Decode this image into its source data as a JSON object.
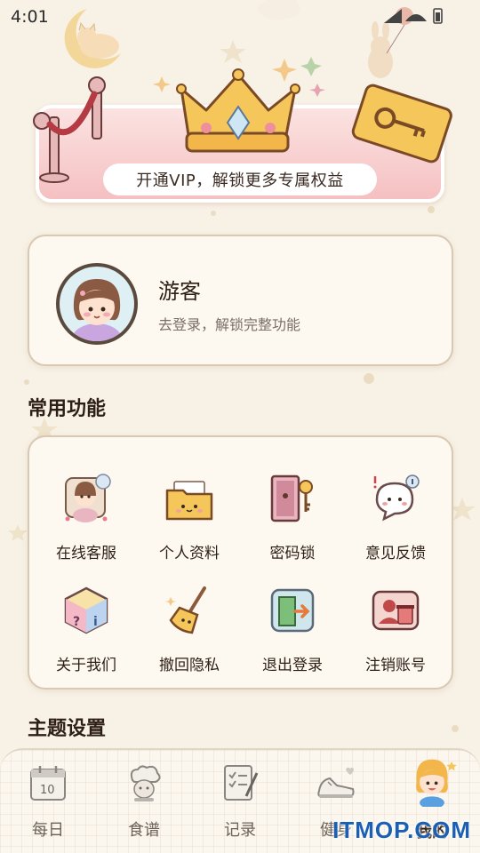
{
  "status_bar": {
    "time": "4:01"
  },
  "vip_banner": {
    "text": "开通VIP，解锁更多专属权益"
  },
  "profile": {
    "name": "游客",
    "subtitle": "去登录，解锁完整功能"
  },
  "sections": {
    "common": "常用功能",
    "theme": "主题设置"
  },
  "functions": [
    {
      "label": "在线客服",
      "icon": "customer-service-icon"
    },
    {
      "label": "个人资料",
      "icon": "folder-icon"
    },
    {
      "label": "密码锁",
      "icon": "door-key-icon"
    },
    {
      "label": "意见反馈",
      "icon": "speech-bubble-icon"
    },
    {
      "label": "关于我们",
      "icon": "info-cube-icon"
    },
    {
      "label": "撤回隐私",
      "icon": "broom-icon"
    },
    {
      "label": "退出登录",
      "icon": "exit-door-icon"
    },
    {
      "label": "注销账号",
      "icon": "delete-account-icon"
    }
  ],
  "nav": [
    {
      "label": "每日",
      "icon": "calendar-icon",
      "active": false
    },
    {
      "label": "食谱",
      "icon": "chef-icon",
      "active": false
    },
    {
      "label": "记录",
      "icon": "notebook-icon",
      "active": false
    },
    {
      "label": "健身",
      "icon": "sneaker-icon",
      "active": false
    },
    {
      "label": "我的",
      "icon": "girl-avatar-icon",
      "active": true
    }
  ],
  "watermark": "ITMOP.COM",
  "colors": {
    "background": "#f8f2e6",
    "banner_pink": "#f5c0c2",
    "card": "#fdf9f1",
    "text": "#2d1f16"
  }
}
